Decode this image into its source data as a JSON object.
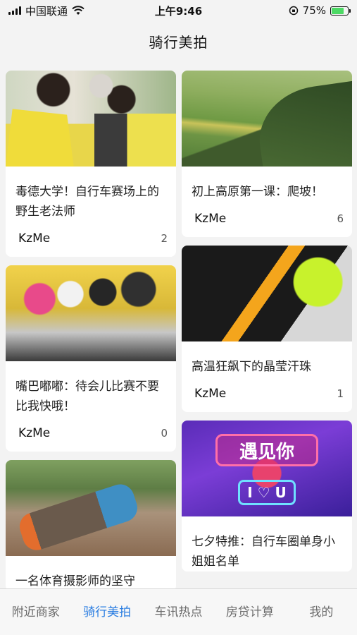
{
  "status_bar": {
    "carrier": "中国联通",
    "time": "上午9:46",
    "battery_percent": "75%",
    "battery_level": 0.75
  },
  "nav": {
    "title": "骑行美拍"
  },
  "feed": {
    "left": [
      {
        "title": "毒德大学！自行车赛场上的野生老法师",
        "author": "KzMe",
        "count": "2",
        "thumb": "riders-yellow-jerseys"
      },
      {
        "title": "嘴巴嘟嘟：待会儿比赛不要比我快哦！",
        "author": "KzMe",
        "count": "0",
        "thumb": "kids-balance-bikes"
      },
      {
        "title": "一名体育摄影师的坚守",
        "author": "",
        "count": "",
        "thumb": "photographer-lying"
      }
    ],
    "right": [
      {
        "title": "初上高原第一课：爬坡！",
        "author": "KzMe",
        "count": "6",
        "thumb": "green-hills"
      },
      {
        "title": "高温狂飙下的晶莹汗珠",
        "author": "KzMe",
        "count": "1",
        "thumb": "cyclist-helmet"
      },
      {
        "title": "七夕特推：自行车圈单身小姐姐名单",
        "author": "",
        "count": "",
        "thumb": "neon-banner"
      }
    ],
    "banner_text": {
      "main": "遇见你",
      "sub": "I ♡ U"
    }
  },
  "tabs": [
    {
      "label": "附近商家",
      "active": false
    },
    {
      "label": "骑行美拍",
      "active": true
    },
    {
      "label": "车讯热点",
      "active": false
    },
    {
      "label": "房贷计算",
      "active": false
    },
    {
      "label": "我的",
      "active": false
    }
  ],
  "colors": {
    "accent": "#2a7de1",
    "background": "#f3f3f3",
    "battery": "#4cd964"
  }
}
